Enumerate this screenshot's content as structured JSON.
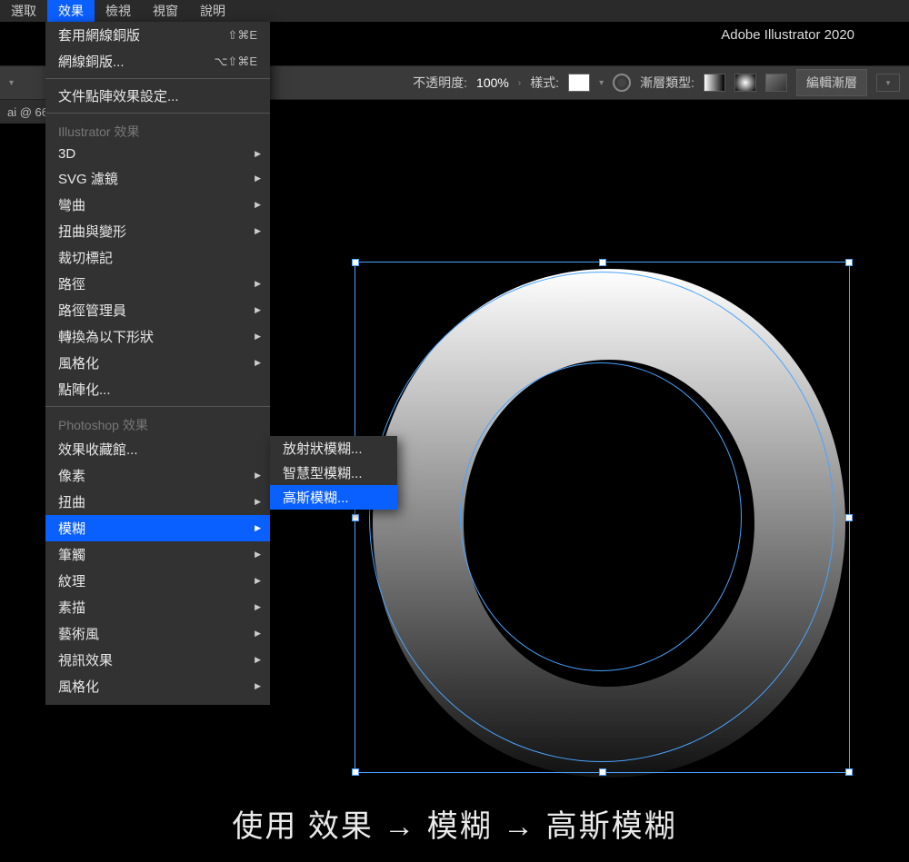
{
  "menubar": {
    "items": [
      "選取",
      "效果",
      "檢視",
      "視窗",
      "說明"
    ],
    "active_index": 1
  },
  "app_title": "Adobe Illustrator 2020",
  "optbar": {
    "opacity_label": "不透明度:",
    "opacity_value": "100%",
    "style_label": "樣式:",
    "gradient_type_label": "漸層類型:",
    "edit_gradient": "編輯漸層"
  },
  "doc_tab": "ai @ 66",
  "effect_menu": {
    "apply_last": "套用網線銅版",
    "apply_last_sc": "⇧⌘E",
    "last_effect": "網線銅版...",
    "last_effect_sc": "⌥⇧⌘E",
    "doc_raster": "文件點陣效果設定...",
    "section1": "Illustrator 效果",
    "items1": [
      "3D",
      "SVG 濾鏡",
      "彎曲",
      "扭曲與變形",
      "裁切標記",
      "路徑",
      "路徑管理員",
      "轉換為以下形狀",
      "風格化",
      "點陣化..."
    ],
    "items1_sub": [
      true,
      true,
      true,
      true,
      false,
      true,
      true,
      true,
      true,
      false
    ],
    "section2": "Photoshop 效果",
    "items2": [
      "效果收藏館...",
      "像素",
      "扭曲",
      "模糊",
      "筆觸",
      "紋理",
      "素描",
      "藝術風",
      "視訊效果",
      "風格化"
    ],
    "items2_sub": [
      false,
      true,
      true,
      true,
      true,
      true,
      true,
      true,
      true,
      true
    ],
    "items2_hl": 3
  },
  "blur_submenu": {
    "items": [
      "放射狀模糊...",
      "智慧型模糊...",
      "高斯模糊..."
    ],
    "hl": 2
  },
  "caption": "使用 效果 → 模糊 → 高斯模糊"
}
